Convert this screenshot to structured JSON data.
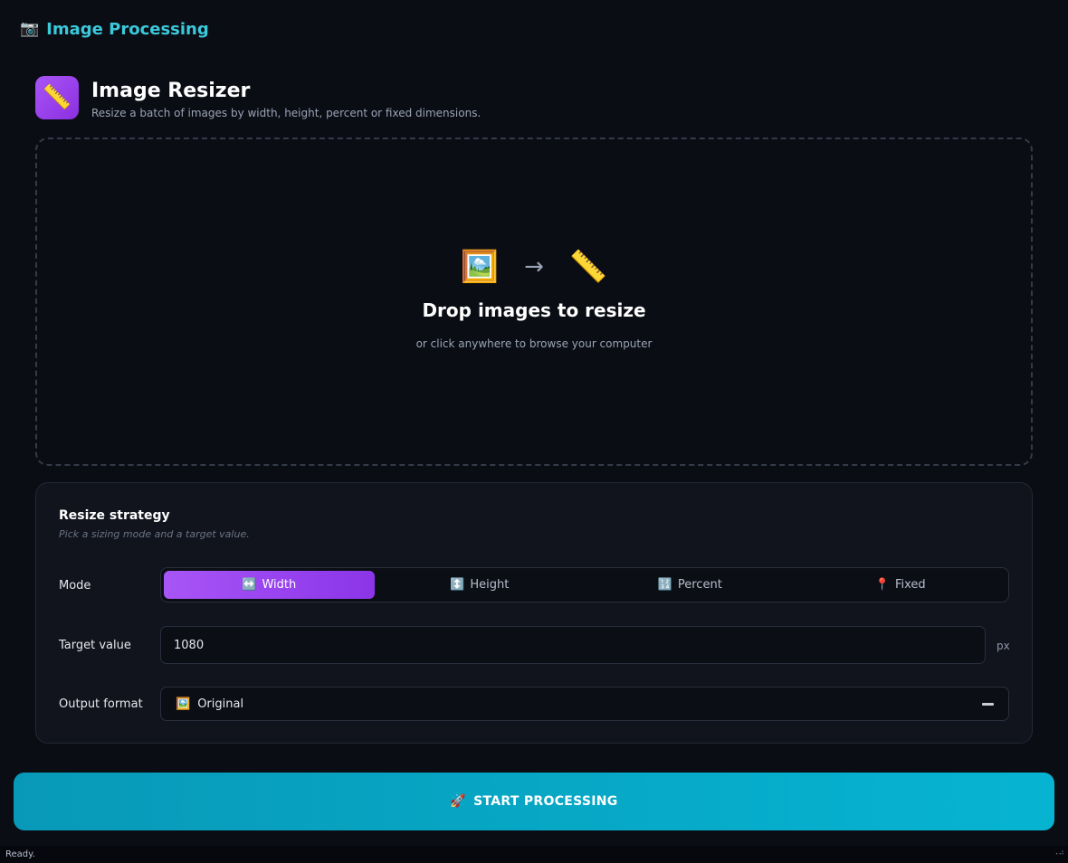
{
  "app": {
    "icon": "camera-icon",
    "title": "Image Processing"
  },
  "tool": {
    "icon": "ruler-icon",
    "title": "Image Resizer",
    "subtitle": "Resize a batch of images by width, height, percent or fixed dimensions."
  },
  "dropzone": {
    "title": "Drop images to resize",
    "subtitle": "or click anywhere to browse your computer",
    "arrow": "→"
  },
  "strategy": {
    "title": "Resize strategy",
    "subtitle": "Pick a sizing mode and a target value.",
    "mode_label": "Mode",
    "modes": [
      {
        "label": "Width",
        "icon": "↔️",
        "active": true
      },
      {
        "label": "Height",
        "icon": "↕️",
        "active": false
      },
      {
        "label": "Percent",
        "icon": "🔢",
        "active": false
      },
      {
        "label": "Fixed",
        "icon": "📍",
        "active": false
      }
    ],
    "target_label": "Target value",
    "target_value": "1080",
    "target_unit": "px",
    "format_label": "Output format",
    "format_icon": "🖼️",
    "format_value": "Original"
  },
  "actions": {
    "start_icon": "🚀",
    "start_label": "START PROCESSING"
  },
  "status": {
    "text": "Ready."
  },
  "colors": {
    "accent_purple": "#a855f7",
    "accent_cyan": "#06b4d2",
    "app_title": "#3bc9db",
    "background": "#0b0d14"
  }
}
